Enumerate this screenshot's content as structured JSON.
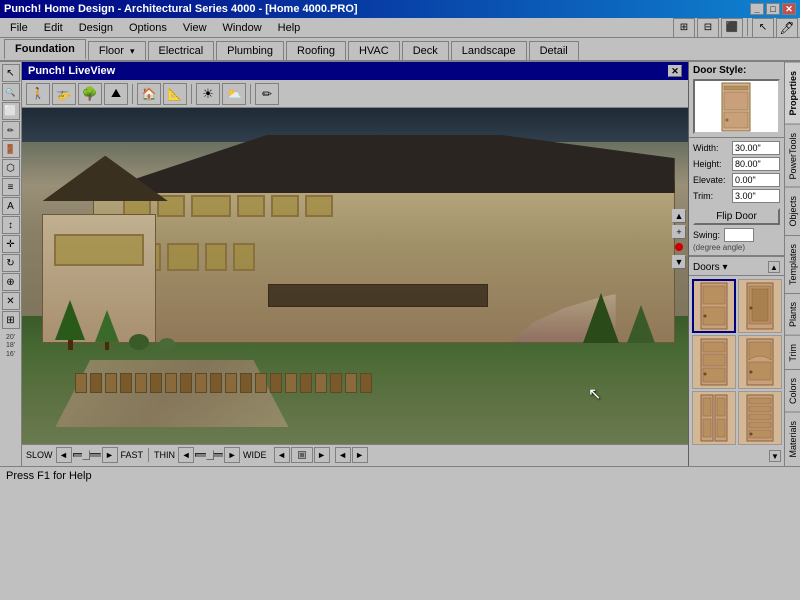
{
  "titleBar": {
    "title": "Punch! Home Design - Architectural Series 4000 - [Home 4000.PRO]",
    "buttons": [
      "_",
      "□",
      "✕"
    ]
  },
  "menuBar": {
    "items": [
      "File",
      "Edit",
      "Design",
      "Options",
      "View",
      "Window",
      "Help"
    ]
  },
  "tabs": {
    "items": [
      "Foundation",
      "Floor ▾",
      "Electrical",
      "Plumbing",
      "Roofing",
      "HVAC",
      "Deck",
      "Landscape",
      "Detail"
    ],
    "active": 0
  },
  "liveview": {
    "title": "Punch! LiveView",
    "speedLabels": [
      "SLOW",
      "FAST",
      "THIN",
      "WIDE"
    ],
    "toolbar": {
      "tools": [
        "🏃",
        "🚁",
        "🌳",
        "🏔",
        "🏠",
        "📐",
        "☀",
        "🌤",
        "🖊"
      ]
    }
  },
  "properties": {
    "doorStyle": "Door Style:",
    "width": {
      "label": "Width:",
      "value": "30.00\""
    },
    "height": {
      "label": "Height:",
      "value": "80.00\""
    },
    "elevate": {
      "label": "Elevate:",
      "value": "0.00\""
    },
    "trim": {
      "label": "Trim:",
      "value": "3.00\""
    },
    "flipBtn": "Flip Door",
    "swing": {
      "label": "Swing:",
      "sublabel": "(degree angle)"
    },
    "doorsSection": "Doors ▾"
  },
  "rightTabs": {
    "items": [
      "Properties",
      "PowerTools",
      "Objects",
      "Templates",
      "Plants",
      "Trim",
      "Colors",
      "Materials"
    ]
  },
  "statusBar": {
    "text": "Press F1 for Help"
  },
  "leftTools": [
    "↖",
    "∿",
    "✚",
    "🔲",
    "⬡",
    "L",
    "A",
    "T",
    "↕",
    "↔",
    "⬡",
    "⊞",
    "≡",
    "◇",
    "⛶"
  ]
}
